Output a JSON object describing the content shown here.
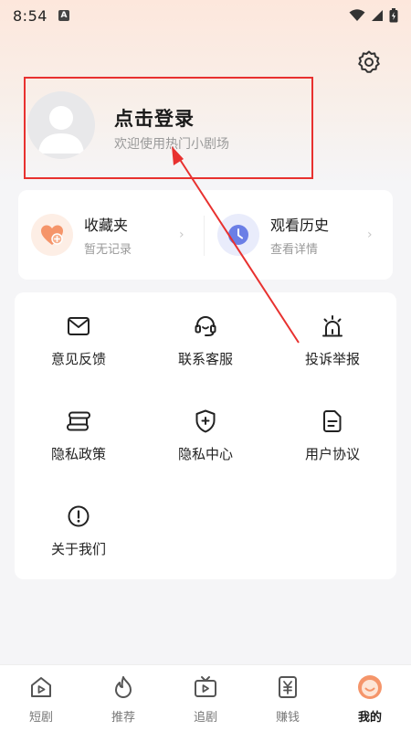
{
  "status_bar": {
    "time": "8:54",
    "notification_letter": "A"
  },
  "profile": {
    "login_title": "点击登录",
    "login_subtitle": "欢迎使用热门小剧场"
  },
  "shortcuts": [
    {
      "title": "收藏夹",
      "subtitle": "暂无记录",
      "icon": "heart-plus-icon",
      "icon_bg": "#fdeee5",
      "icon_color": "#f5956a"
    },
    {
      "title": "观看历史",
      "subtitle": "查看详情",
      "icon": "clock-icon",
      "icon_bg": "#e9ecfb",
      "icon_color": "#6b7fe6"
    }
  ],
  "menu": [
    {
      "label": "意见反馈",
      "icon": "mail-icon"
    },
    {
      "label": "联系客服",
      "icon": "headset-icon"
    },
    {
      "label": "投诉举报",
      "icon": "alarm-light-icon"
    },
    {
      "label": "隐私政策",
      "icon": "privacy-scroll-icon"
    },
    {
      "label": "隐私中心",
      "icon": "shield-plus-icon"
    },
    {
      "label": "用户协议",
      "icon": "document-icon"
    },
    {
      "label": "关于我们",
      "icon": "info-circle-icon"
    }
  ],
  "tabs": [
    {
      "label": "短剧",
      "icon": "home-play-icon",
      "active": false
    },
    {
      "label": "推荐",
      "icon": "flame-icon",
      "active": false
    },
    {
      "label": "追剧",
      "icon": "tv-icon",
      "active": false
    },
    {
      "label": "赚钱",
      "icon": "yuan-coin-icon",
      "active": false
    },
    {
      "label": "我的",
      "icon": "smiley-face-icon",
      "active": true
    }
  ],
  "colors": {
    "accent": "#f5956a",
    "highlight_box": "#e8312f",
    "annotation_arrow": "#e8312f"
  }
}
